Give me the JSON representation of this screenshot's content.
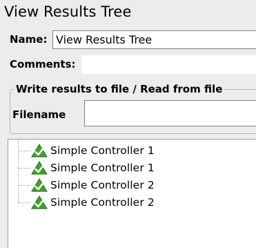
{
  "title": "View Results Tree",
  "name": {
    "label": "Name:",
    "value": "View Results Tree"
  },
  "comments": {
    "label": "Comments:",
    "value": ""
  },
  "file_section": {
    "title": "Write results to file / Read from file",
    "filename_label": "Filename",
    "filename_value": ""
  },
  "tree": {
    "items": [
      {
        "label": "Simple Controller 1",
        "icon": "success-check-icon"
      },
      {
        "label": "Simple Controller 1",
        "icon": "success-check-icon"
      },
      {
        "label": "Simple Controller 2",
        "icon": "success-check-icon"
      },
      {
        "label": "Simple Controller 2",
        "icon": "success-check-icon"
      }
    ]
  },
  "colors": {
    "success_icon": "#3fa32b",
    "panel_background": "#ececec",
    "field_background": "#ffffff"
  }
}
